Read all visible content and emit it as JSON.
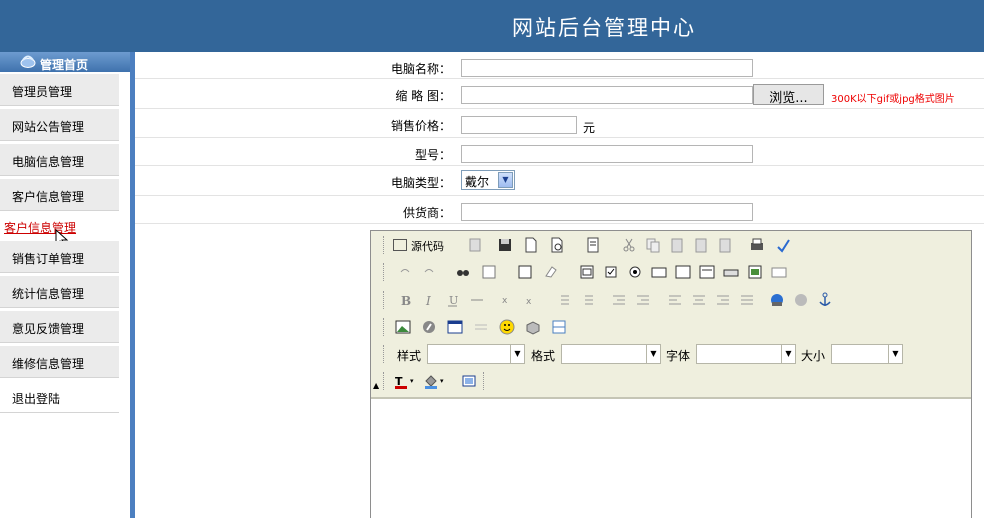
{
  "header": {
    "title": "网站后台管理中心"
  },
  "sidebar": {
    "home_label": "管理首页",
    "items": [
      {
        "label": "管理员管理"
      },
      {
        "label": "网站公告管理"
      },
      {
        "label": "电脑信息管理"
      },
      {
        "label": "客户信息管理"
      },
      {
        "label": "销售订单管理"
      },
      {
        "label": "统计信息管理"
      },
      {
        "label": "意见反馈管理"
      },
      {
        "label": "维修信息管理"
      },
      {
        "label": "退出登陆"
      }
    ],
    "hover_link": "客户信息管理"
  },
  "form": {
    "name_label": "电脑名称：",
    "name_value": "",
    "thumb_label": "缩 略 图：",
    "thumb_value": "",
    "browse_label": "浏览...",
    "thumb_note": "300K以下gif或jpg格式图片",
    "price_label": "销售价格：",
    "price_value": "",
    "price_unit": "元",
    "model_label": "型号：",
    "model_value": "",
    "type_label": "电脑类型：",
    "type_value": "戴尔",
    "supplier_label": "供货商：",
    "supplier_value": ""
  },
  "editor": {
    "source_label": "源代码",
    "style_label": "样式",
    "format_label": "格式",
    "font_label": "字体",
    "size_label": "大小",
    "style_value": "",
    "format_value": "",
    "font_value": "",
    "size_value": "",
    "content": ""
  }
}
